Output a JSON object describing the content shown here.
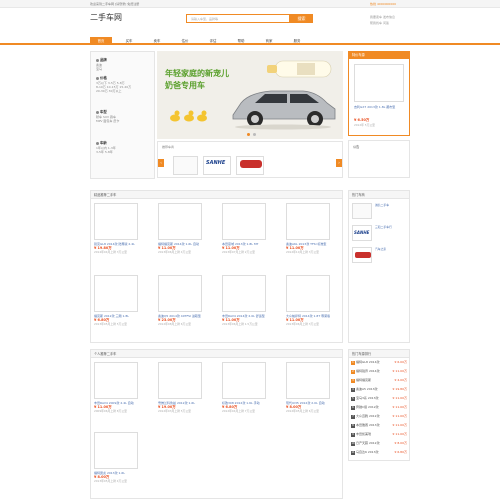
{
  "topbar": {
    "left": "欢迎来到二手车网 [请登录] 免费注册",
    "right": "热线 4000000000"
  },
  "logo": "二手车网",
  "search": {
    "placeholder": "请输入车型，品牌等",
    "button": "搜索"
  },
  "header_right": {
    "line1": "我要卖车 发布信息",
    "line2": "帮我找车 问答"
  },
  "nav": [
    "首页",
    "买车",
    "卖车",
    "估价",
    "评估",
    "帮助",
    "商家",
    "服务"
  ],
  "left": {
    "sections": [
      {
        "title": "品牌",
        "items": [
          "奥迪",
          "宝马",
          "本田"
        ]
      },
      {
        "title": "价格",
        "items": [
          "3万以下 3-5万 5-8万",
          "8-10万 10-15万 15-20万",
          "20-30万 30万以上"
        ]
      },
      {
        "title": "车型",
        "items": [
          "轿车 SUV 跑车",
          "MPV 面包车 皮卡"
        ]
      },
      {
        "title": "车龄",
        "items": [
          "1年以内 1-3年",
          "3-5年 5-8年"
        ]
      }
    ]
  },
  "banner": {
    "line1": "年轻家庭的新宠儿",
    "line2": "奶爸专用车"
  },
  "brands": {
    "label": "推荐车商",
    "names": [
      "SANHE",
      "SANHE"
    ]
  },
  "right": {
    "title": "特价车源",
    "item": "吉利GX7 2013款 1.8L 都市型",
    "price": "¥ 6.50万",
    "desc": "2012年 5万公里"
  },
  "right2": {
    "title": "公告"
  },
  "sec1": {
    "title": "精品推荐二手车"
  },
  "sec2": {
    "title": "个人推荐二手车"
  },
  "dealer": {
    "title": "热门车商",
    "items": [
      "诚信二手车",
      "三和二手车行",
      "汽车之家"
    ]
  },
  "cars1": [
    {
      "t": "别克GL8 2014款 陆尊版 2.4L",
      "p": "¥ 19.80万",
      "m": "2014年04月上牌 3万公里"
    },
    {
      "t": "福特福克斯 2014款 1.6L 自动",
      "p": "¥ 11.00万",
      "m": "2013年06月上牌 4万公里"
    },
    {
      "t": "本田思域 2013款 1.8L MT",
      "p": "¥ 11.00万",
      "m": "2013年07月上牌 2万公里"
    },
    {
      "t": "奥迪A6L 2013款 TFSI 标准型",
      "p": "¥ 11.00万",
      "m": "2012年10月上牌 3万公里"
    },
    {
      "t": "福克斯 2012款 三厢 1.8L",
      "p": "¥ 6.80万",
      "m": "2013年05月上牌 5万公里"
    },
    {
      "t": "奥迪Q5 2014款 40TFSI 进取型",
      "p": "¥ 23.00万",
      "m": "2012年08月上牌 6万公里"
    },
    {
      "t": "丰田RAV4 2014款 2.0L 舒适型",
      "p": "¥ 11.00万",
      "m": "2013年06月上牌 1.5万公里"
    },
    {
      "t": "大众帕萨特 2014款 1.8T 尊荣版",
      "p": "¥ 11.00万",
      "m": "2013年06月上牌 3万公里"
    }
  ],
  "cars2": [
    {
      "t": "丰田RAV4 2009款 2.4L 自动",
      "p": "¥ 11.00万",
      "m": "2009年06月上牌 8万公里"
    },
    {
      "t": "雪佛兰科鲁兹 2012款 1.6L",
      "p": "¥ 19.00万",
      "m": "2012年03月上牌 5万公里"
    },
    {
      "t": "标致308 2012款 1.6L 手动",
      "p": "¥ 6.80万",
      "m": "2012年04月上牌 7万公里"
    },
    {
      "t": "现代IX35 2012款 2.0L 自动",
      "p": "¥ 8.00万",
      "m": "2012年05月上牌 6万公里"
    },
    {
      "t": "福特翼虎 2013款 1.6L",
      "p": "¥ 8.00万",
      "m": "2013年05月上牌 4万公里"
    }
  ],
  "rank": {
    "title": "热门车源排行",
    "items": [
      {
        "n": "1",
        "t": "福特GL8 2014款",
        "p": "¥ 6.00万"
      },
      {
        "n": "2",
        "t": "福特锐界 2014款",
        "p": "¥ 11.00万"
      },
      {
        "n": "3",
        "t": "福特福克斯",
        "p": "¥ 4.00万"
      },
      {
        "n": "4",
        "t": "奥迪A5 2013款",
        "p": "¥ 19.80万"
      },
      {
        "n": "5",
        "t": "宝马3系 2013款",
        "p": "¥ 11.00万"
      },
      {
        "n": "6",
        "t": "奔驰C级 2012款",
        "p": "¥ 11.00万"
      },
      {
        "n": "7",
        "t": "大众迈腾 2012款",
        "p": "¥ 11.00万"
      },
      {
        "n": "8",
        "t": "本田雅阁 2013款",
        "p": "¥ 11.00万"
      },
      {
        "n": "9",
        "t": "丰田凯美瑞",
        "p": "¥ 11.00万"
      },
      {
        "n": "10",
        "t": "日产天籁 2012款",
        "p": "¥ 8.00万"
      },
      {
        "n": "11",
        "t": "马自达6 2013款",
        "p": "¥ 6.80万"
      }
    ]
  }
}
